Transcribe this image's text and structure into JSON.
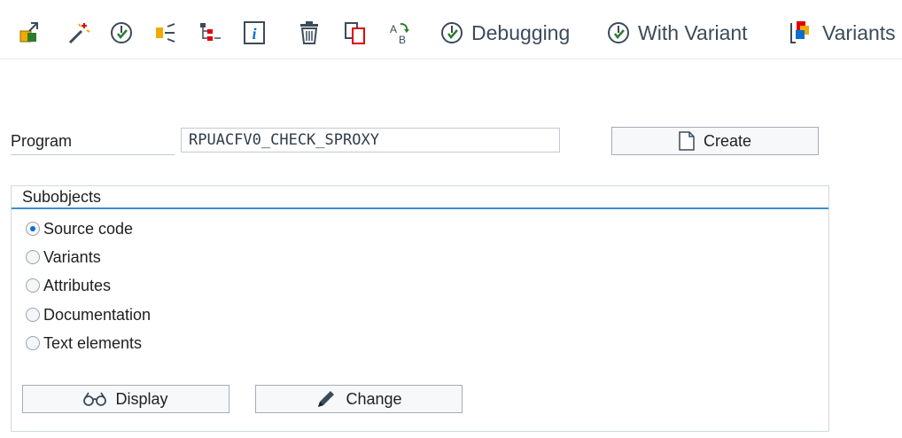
{
  "toolbar": {
    "icons": [
      "other-object-icon",
      "magic-wand-icon",
      "check-icon",
      "where-used-icon",
      "hierarchy-icon",
      "info-icon",
      "delete-icon",
      "copy-icon",
      "rename-icon"
    ],
    "debugging_label": "Debugging",
    "with_variant_label": "With Variant",
    "variants_label": "Variants"
  },
  "program": {
    "label": "Program",
    "value": "RPUACFV0_CHECK_SPROXY",
    "create_label": "Create"
  },
  "subobjects": {
    "title": "Subobjects",
    "options": [
      {
        "label": "Source code",
        "checked": true
      },
      {
        "label": "Variants",
        "checked": false
      },
      {
        "label": "Attributes",
        "checked": false
      },
      {
        "label": "Documentation",
        "checked": false
      },
      {
        "label": "Text elements",
        "checked": false
      }
    ]
  },
  "actions": {
    "display_label": "Display",
    "change_label": "Change"
  },
  "colors": {
    "accent_blue": "#0a6ed1",
    "icon_orange": "#f0ab00",
    "icon_green": "#2b7d2b",
    "icon_red": "#e00000",
    "group_underline": "#3a8fd0"
  }
}
